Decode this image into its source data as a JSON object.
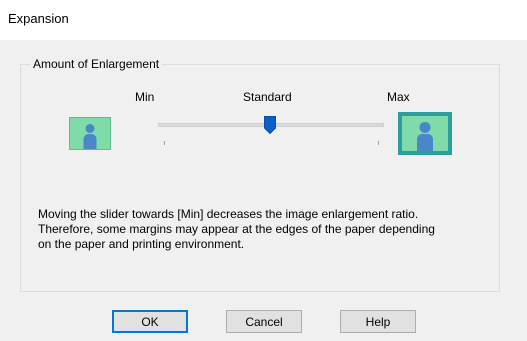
{
  "window": {
    "title": "Expansion"
  },
  "group": {
    "label": "Amount of Enlargement"
  },
  "slider": {
    "min_label": "Min",
    "mid_label": "Standard",
    "max_label": "Max",
    "position_fraction": 0.5
  },
  "description": {
    "lines": [
      "Moving the slider towards [Min] decreases the image enlargement ratio.",
      "Therefore, some margins may appear at the edges of the paper depending",
      "on the paper and printing environment."
    ]
  },
  "buttons": {
    "ok": "OK",
    "cancel": "Cancel",
    "help": "Help"
  },
  "colors": {
    "accent": "#0078d7",
    "image_bg": "#7fdcaa",
    "image_border_max": "#2c9e9b",
    "person": "#4a86c8",
    "thumb": "#0c5fc4"
  },
  "icons": {
    "min_image": "person-image-icon",
    "max_image": "person-image-icon",
    "slider_thumb": "slider-thumb-icon"
  }
}
